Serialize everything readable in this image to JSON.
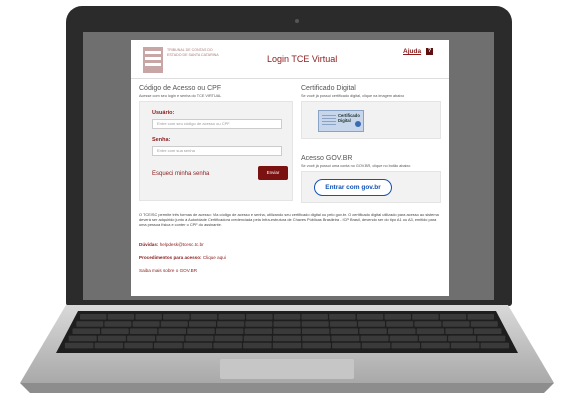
{
  "header": {
    "logo_text": "TRIBUNAL DE CONTAS DO ESTADO DE SANTA CATARINA",
    "title": "Login TCE Virtual",
    "help_label": "Ajuda",
    "help_icon_glyph": "?"
  },
  "access": {
    "title": "Código de Acesso ou CPF",
    "subtitle": "Acesse com seu login e senha do TCE VIRTUAL",
    "user_label": "Usuário:",
    "user_placeholder": "Entre com seu código de acesso ou CPF",
    "password_label": "Senha:",
    "password_placeholder": "Entre com sua senha",
    "forgot_label": "Esqueci minha senha",
    "send_label": "Enviar"
  },
  "certificate": {
    "title": "Certificado Digital",
    "subtitle": "Se você já possui certificado digital, clique na imagem abaixo",
    "button_text": "Certificado Digital"
  },
  "govbr": {
    "title": "Acesso GOV.BR",
    "subtitle": "Se você já possui uma conta no GOV.BR, clique no botão abaixo",
    "button_label": "Entrar com gov.br"
  },
  "footer": {
    "info": "O TCE/SC permite três formas de acesso: Via código de acesso e senha, utilizando seu certificado digital ou pelo gov.br. O certificado digital utilizado para acesso ao sistema deverá ser adquirido junto à Autoridade Certificadora credenciada pela Infra-estrutura de Chaves Públicas Brasileira - ICP Brasil, devendo ser do tipo A1 ou A3, emitido para uma pessoa física e conter o CPF do assinante.",
    "doubts_label": "Dúvidas:",
    "doubts_email": "helpdesk@tcesc.tc.br",
    "procedures_label": "Procedimentos para acesso:",
    "procedures_link": "Clique aqui",
    "govbr_link": "Saiba mais sobre o GOV.BR"
  },
  "colors": {
    "brand": "#8a1c1c",
    "govbr": "#1351b4"
  }
}
